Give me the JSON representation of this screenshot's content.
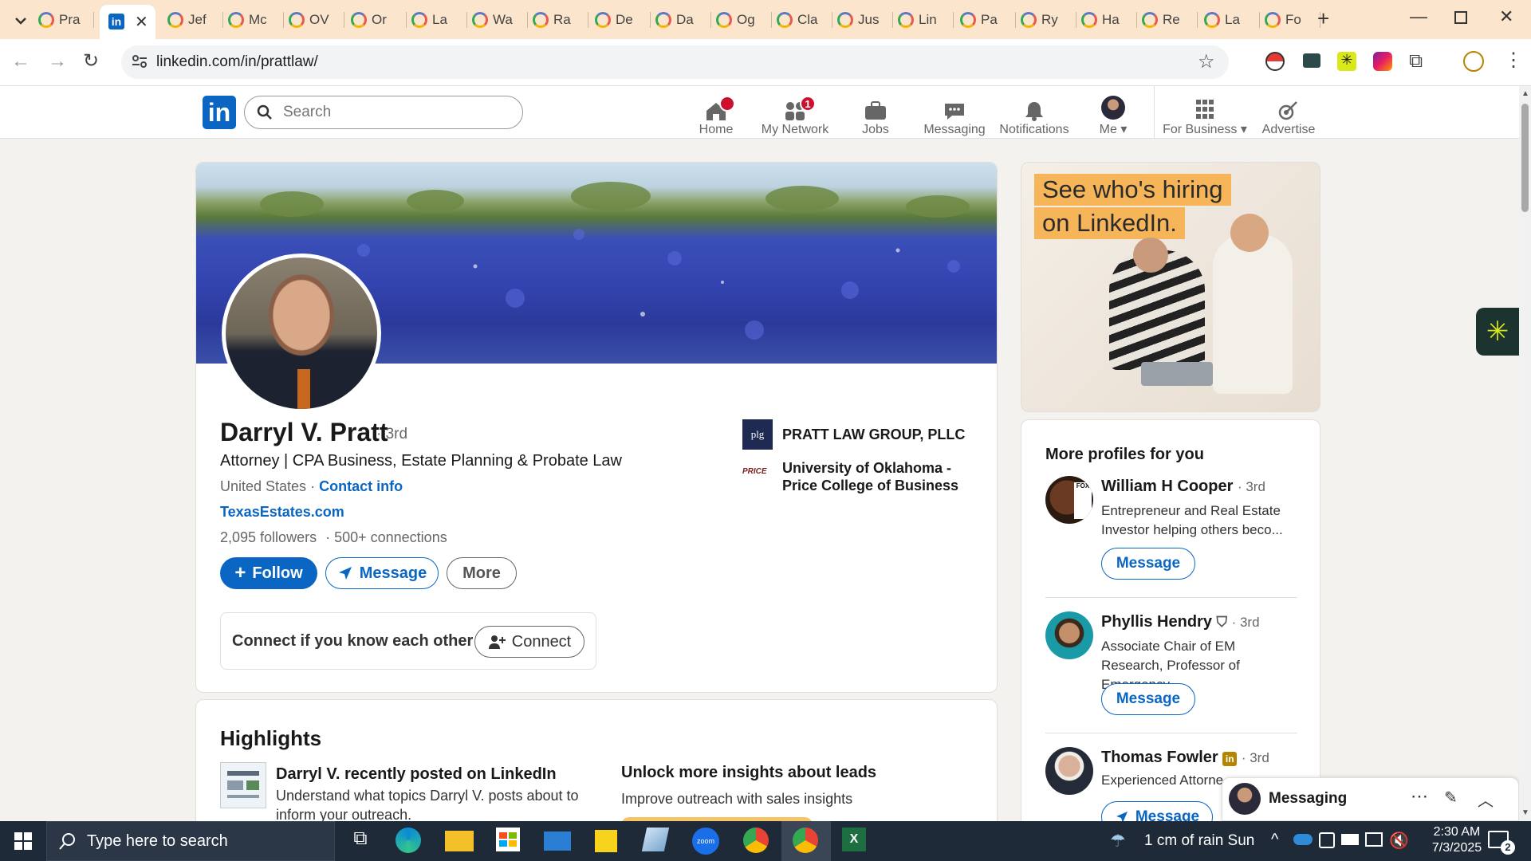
{
  "browser": {
    "tabs": [
      "Pra",
      "",
      "Jef",
      "Mc",
      "OV",
      "Or",
      "La",
      "Wa",
      "Ra",
      "De",
      "Da",
      "Og",
      "Cla",
      "Jus",
      "Lin",
      "Pa",
      "Ry",
      "Ha",
      "Re",
      "La",
      "Fo"
    ],
    "url": "linkedin.com/in/prattlaw/"
  },
  "nav": {
    "search_placeholder": "Search",
    "items": [
      {
        "label": "Home",
        "badge": ""
      },
      {
        "label": "My Network",
        "badge": "1"
      },
      {
        "label": "Jobs",
        "badge": ""
      },
      {
        "label": "Messaging",
        "badge": ""
      },
      {
        "label": "Notifications",
        "badge": ""
      },
      {
        "label": "Me",
        "badge": ""
      },
      {
        "label": "For Business",
        "badge": ""
      },
      {
        "label": "Advertise",
        "badge": ""
      }
    ]
  },
  "profile": {
    "name": "Darryl V. Pratt",
    "degree": "· 3rd",
    "headline": "Attorney | CPA Business, Estate Planning & Probate Law",
    "location": "United States",
    "location_sep": "·",
    "contact_label": "Contact info",
    "website": "TexasEstates.com",
    "followers": "2,095 followers",
    "connections": "· 500+ connections",
    "follow_label": "Follow",
    "message_label": "Message",
    "more_label": "More",
    "company": "PRATT LAW GROUP, PLLC",
    "company_logo": "plg",
    "education": "University of Oklahoma - Price College of Business",
    "edu_logo": "PRICE",
    "connect_prompt": "Connect if you know each other",
    "connect_label": "Connect"
  },
  "highlights": {
    "title": "Highlights",
    "item_title": "Darryl V. recently posted on LinkedIn",
    "item_desc": "Understand what topics Darryl V. posts about to inform your outreach.",
    "insights_title": "Unlock more insights about leads",
    "insights_desc": "Improve outreach with sales insights"
  },
  "ad": {
    "line1": "See who's hiring",
    "line2": "on LinkedIn."
  },
  "sidebar": {
    "title": "More profiles for you",
    "profiles": [
      {
        "name": "William H Cooper",
        "degree": "· 3rd",
        "headline": "Entrepreneur and Real Estate Investor helping others beco...",
        "button": "Message"
      },
      {
        "name": "Phyllis Hendry",
        "degree": "· 3rd",
        "headline": "Associate Chair of EM Research, Professor of Emergency...",
        "button": "Message"
      },
      {
        "name": "Thomas Fowler",
        "degree": "· 3rd",
        "headline": "Experienced Attorne",
        "button": "Message"
      }
    ]
  },
  "messaging": {
    "label": "Messaging"
  },
  "taskbar": {
    "search_placeholder": "Type here to search",
    "weather": "1 cm of rain Sun",
    "time": "2:30 AM",
    "date": "7/3/2025",
    "notif_count": "2"
  },
  "colors": {
    "linkedin_blue": "#0a66c2",
    "tabstrip": "#fbe5cc",
    "badge_red": "#cb112d"
  }
}
